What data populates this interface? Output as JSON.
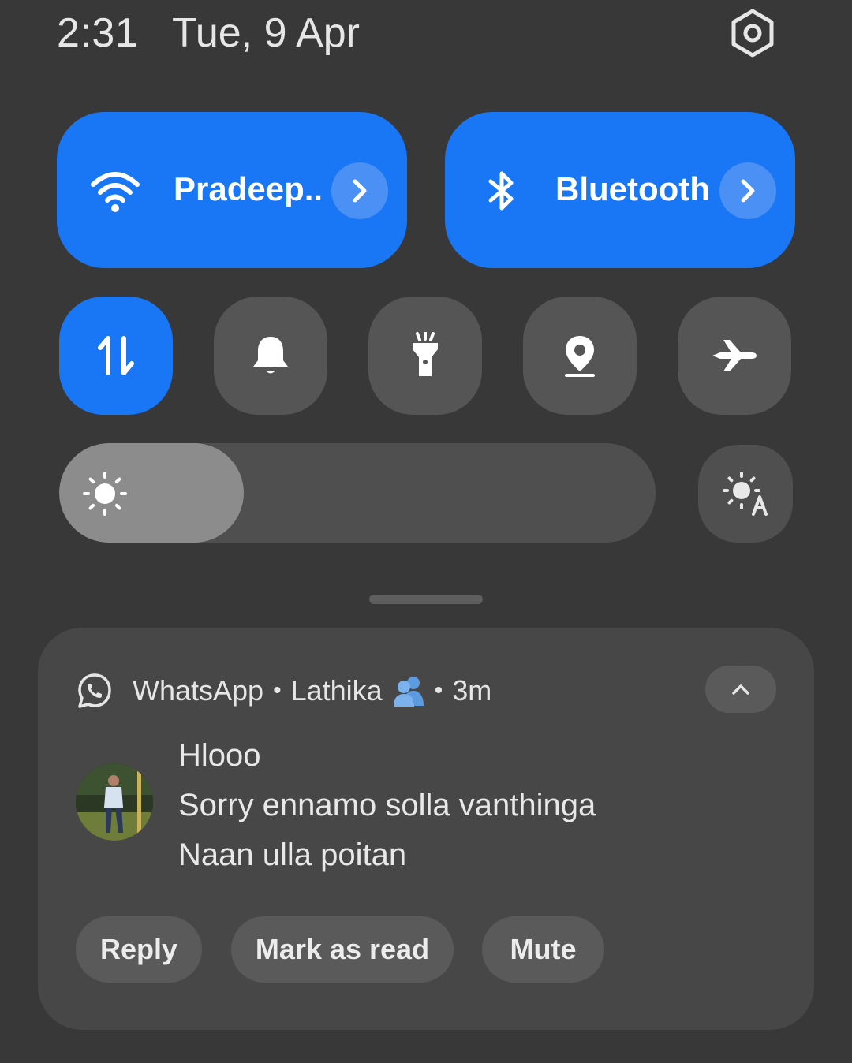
{
  "status": {
    "time": "2:31",
    "date": "Tue, 9 Apr"
  },
  "quick_settings": {
    "wifi": {
      "label": "Pradeep..",
      "icon": "wifi-icon",
      "active": true
    },
    "bluetooth": {
      "label": "Bluetooth",
      "icon": "bluetooth-icon",
      "active": true
    },
    "toggles": [
      {
        "icon": "mobile-data-icon",
        "active": true
      },
      {
        "icon": "sound-bell-icon",
        "active": false
      },
      {
        "icon": "flashlight-icon",
        "active": false
      },
      {
        "icon": "location-icon",
        "active": false
      },
      {
        "icon": "airplane-mode-icon",
        "active": false
      }
    ],
    "brightness_level": 0.31,
    "colors": {
      "active": "#1976f5",
      "inactive": "#555555",
      "background": "#383838"
    }
  },
  "notification": {
    "app": "WhatsApp",
    "sender": "Lathika",
    "time_ago": "3m",
    "separator": "•",
    "messages": [
      "Hlooo",
      "Sorry ennamo solla vanthinga",
      "Naan ulla poitan"
    ],
    "actions": {
      "reply": "Reply",
      "mark_read": "Mark as read",
      "mute": "Mute"
    }
  }
}
